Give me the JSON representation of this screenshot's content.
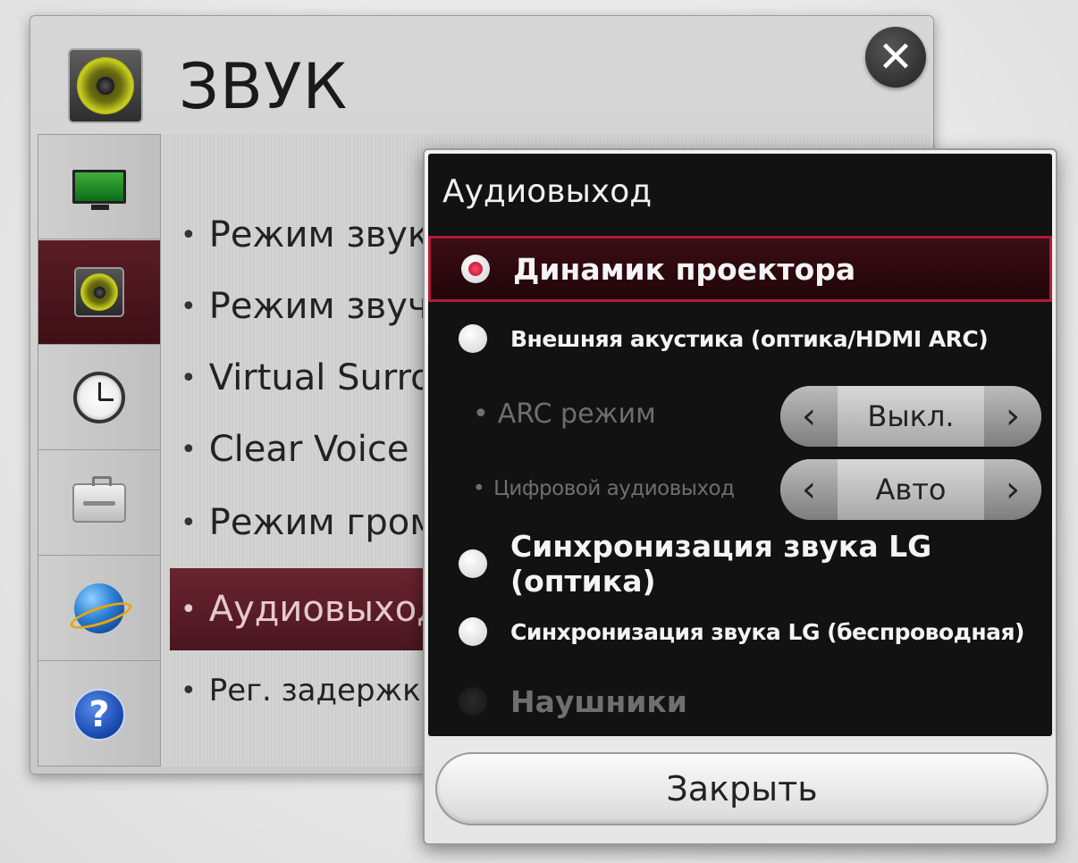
{
  "header": {
    "title": "ЗВУК",
    "icon": "speaker-icon",
    "close_icon": "close-icon"
  },
  "sidebar": {
    "items": [
      {
        "name": "picture",
        "icon": "monitor-icon"
      },
      {
        "name": "sound",
        "icon": "speaker-icon",
        "active": true
      },
      {
        "name": "time",
        "icon": "clock-icon"
      },
      {
        "name": "settings",
        "icon": "toolbox-icon"
      },
      {
        "name": "network",
        "icon": "globe-icon"
      },
      {
        "name": "support",
        "icon": "help-icon",
        "glyph": "?"
      }
    ]
  },
  "menu": {
    "items": [
      {
        "label": "Режим звука"
      },
      {
        "label": "Режим звучания"
      },
      {
        "label": "Virtual Surround"
      },
      {
        "label": "Clear Voice II"
      },
      {
        "label": "Режим громкости"
      },
      {
        "label": "Аудиовыход",
        "active": true
      },
      {
        "label": "Рег. задержки звука"
      }
    ],
    "bullet": "•"
  },
  "dialog": {
    "title": "Аудиовыход",
    "options": [
      {
        "label": "Динамик проектора",
        "selected": true
      },
      {
        "label": "Внешняя акустика (оптика/HDMI ARC)"
      },
      {
        "label": "Синхронизация звука LG (оптика)"
      },
      {
        "label": "Синхронизация звука LG (беспроводная)"
      },
      {
        "label": "Наушники",
        "disabled": true
      }
    ],
    "sub_settings": [
      {
        "label": "ARC режим",
        "value": "Выкл.",
        "prev": "‹",
        "next": "›"
      },
      {
        "label": "Цифровой аудиовыход",
        "value": "Авто",
        "prev": "‹",
        "next": "›"
      }
    ],
    "close_label": "Закрыть"
  },
  "colors": {
    "accent": "#b21b37",
    "active_menu": "#5a1c24",
    "dialog_bg": "#121212"
  }
}
